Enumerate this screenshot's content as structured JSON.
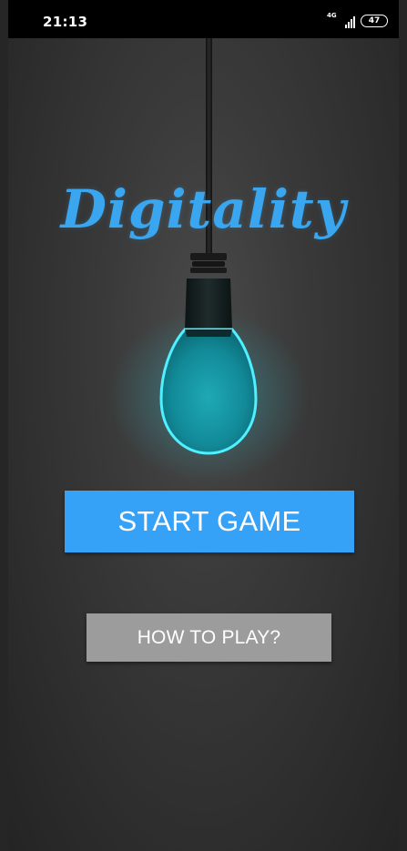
{
  "status_bar": {
    "time": "21:13",
    "network_type": "4G",
    "battery_level": "47",
    "signal_icon": "signal-bars-icon",
    "battery_icon": "battery-icon"
  },
  "app": {
    "title": "Digitality",
    "title_color": "#3aa6f0",
    "bulb_glow_color": "#2ec8d8"
  },
  "buttons": {
    "start_game_label": "START GAME",
    "start_game_color": "#36a2f7",
    "how_to_play_label": "HOW TO PLAY?",
    "how_to_play_color": "#9c9c9c"
  }
}
